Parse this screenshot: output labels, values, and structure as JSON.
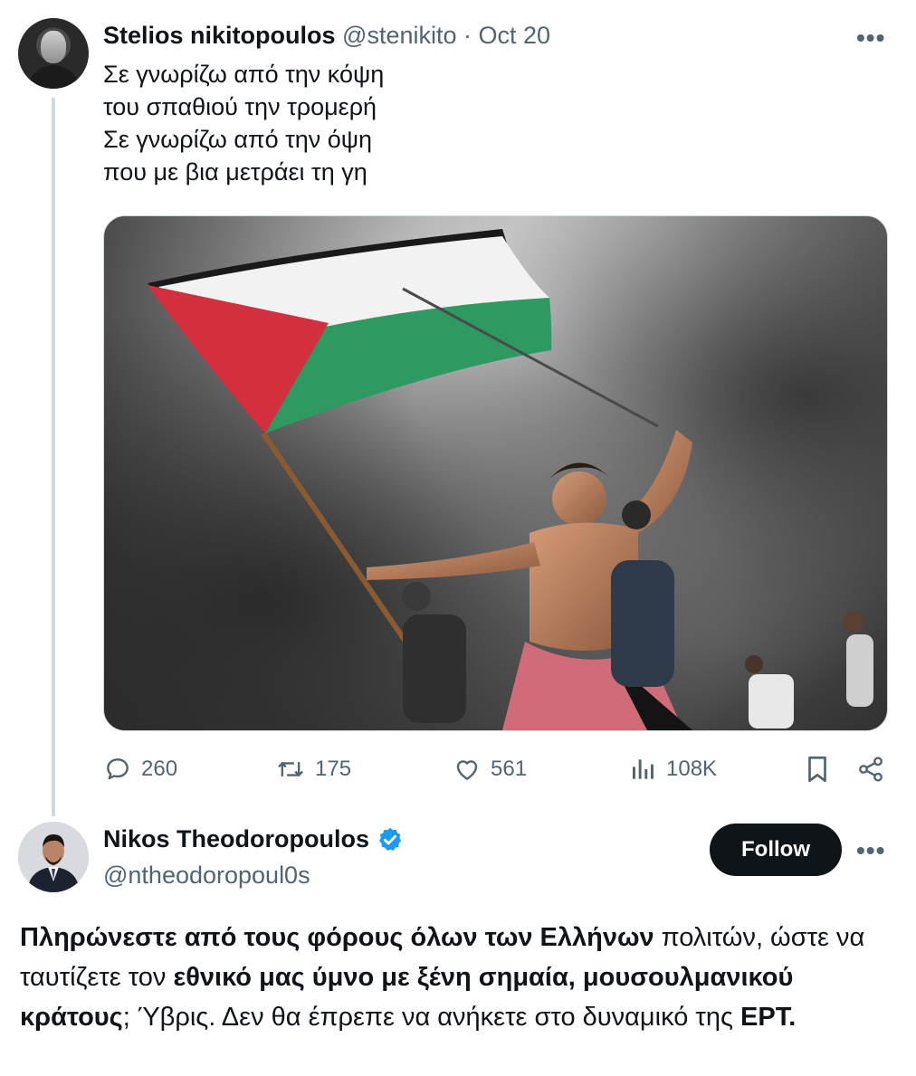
{
  "tweet": {
    "author_name": "Stelios nikitopoulos",
    "handle": "@stenikito",
    "separator": "·",
    "date": "Oct 20",
    "more": "•••",
    "lines": [
      "Σε γνωρίζω από την κόψη",
      "του σπαθιού την τρομερή",
      "Σε γνωρίζω από την όψη",
      "που με βια μετράει τη γη"
    ],
    "stats": {
      "replies": "260",
      "reposts": "175",
      "likes": "561",
      "views": "108K"
    }
  },
  "reply": {
    "author_name": "Nikos Theodoropoulos",
    "handle": "@ntheodoropoul0s",
    "follow_label": "Follow",
    "more": "•••",
    "text_parts": {
      "p1": "Πληρώνεστε από τους φόρους όλων των Ελλήνων",
      "p2": " πολιτών, ώστε να ταυτίζετε τον ",
      "p3": "εθνικό μας ύμνο με ξένη σημαία, μουσουλμανικού κράτους",
      "p4": "; Ύβρις. Δεν θα έπρεπε να ανήκετε στο δυναμικό της ",
      "p5": "ΕΡΤ."
    }
  },
  "colors": {
    "text": "#0f1419",
    "muted": "#536471",
    "verified": "#1d9bf0",
    "flag_red": "#d32f3f",
    "flag_green": "#2e9a62",
    "flag_black": "#1a1a1a"
  }
}
